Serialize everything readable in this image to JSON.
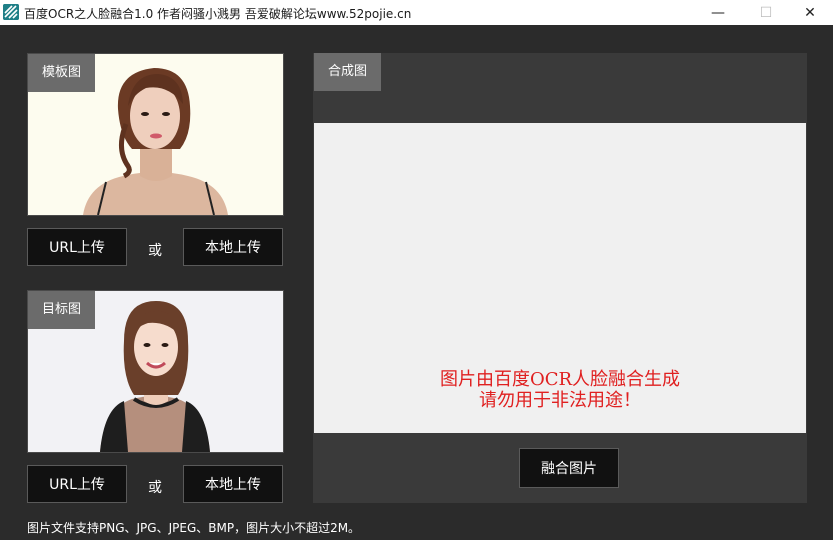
{
  "window": {
    "title": "百度OCR之人脸融合1.0 作者闷骚小溅男 吾爱破解论坛www.52pojie.cn",
    "minimize_glyph": "—",
    "maximize_glyph": "☐",
    "close_glyph": "✕"
  },
  "template": {
    "tab_label": "模板图",
    "url_button": "URL上传",
    "or_label": "或",
    "local_button": "本地上传"
  },
  "target": {
    "tab_label": "目标图",
    "url_button": "URL上传",
    "or_label": "或",
    "local_button": "本地上传"
  },
  "result": {
    "tab_label": "合成图",
    "notice_line1": "图片由百度OCR人脸融合生成",
    "notice_line2": "请勿用于非法用途！",
    "merge_button": "融合图片"
  },
  "footer": {
    "note": "图片文件支持PNG、JPG、JPEG、BMP，图片大小不超过2M。"
  },
  "colors": {
    "background": "#2b2b2b",
    "tab_bg": "#6b6b6b",
    "button_bg": "#111111",
    "notice_red": "#e02020",
    "canvas_bg": "#f0f0f0"
  },
  "icons": {
    "app": "app-logo-icon",
    "minimize": "minimize-icon",
    "maximize": "maximize-icon",
    "close": "close-icon"
  }
}
